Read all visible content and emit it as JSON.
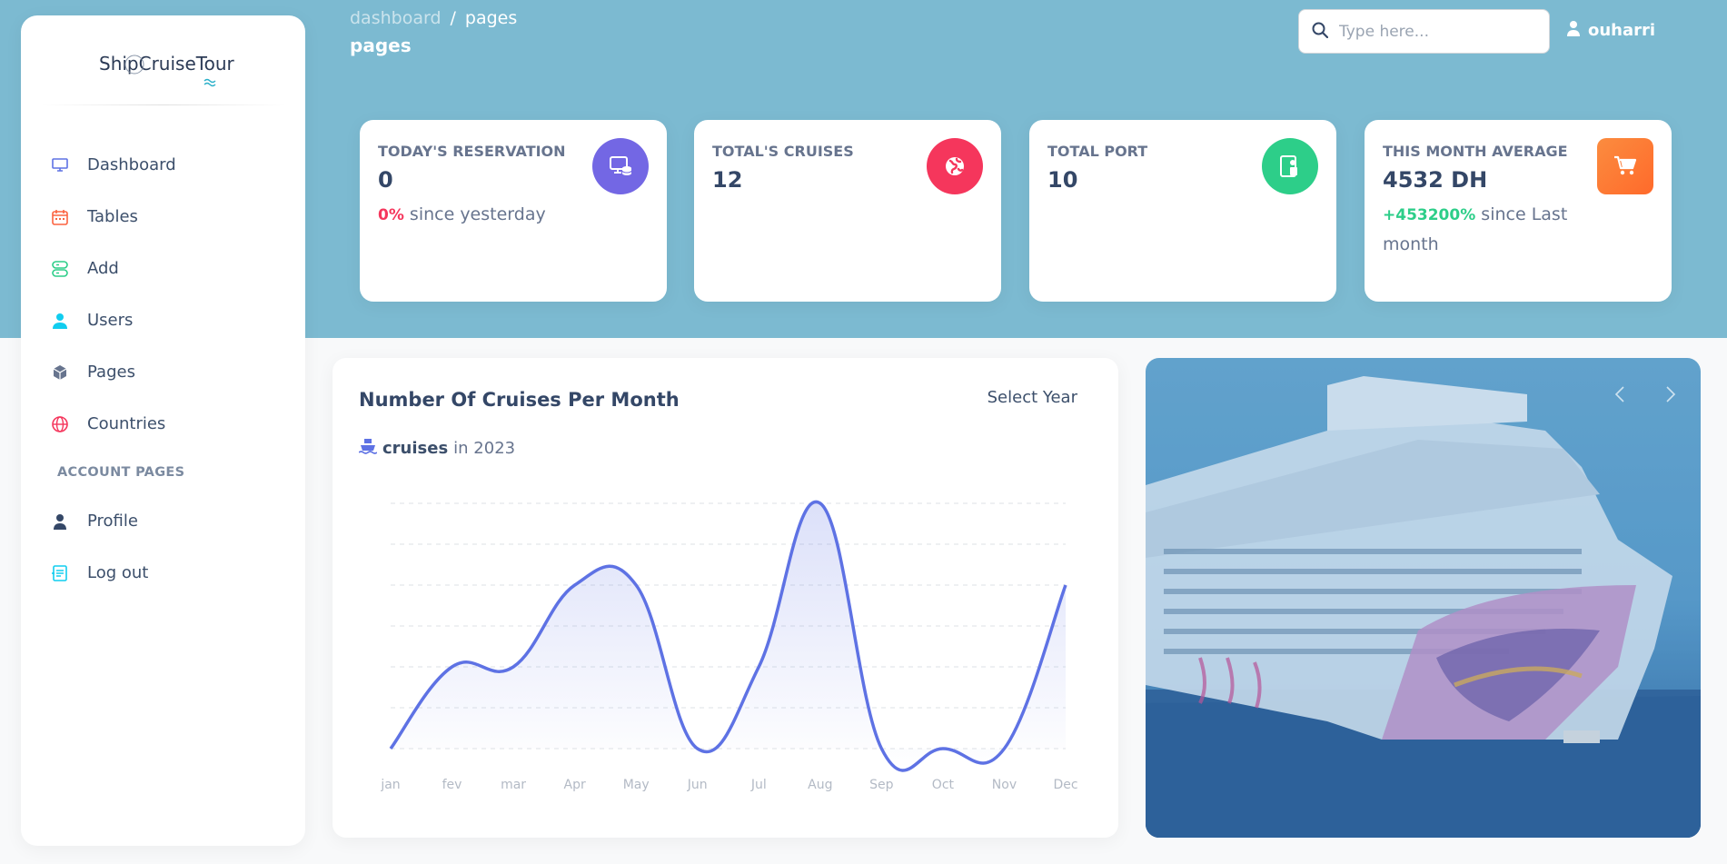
{
  "brand": {
    "logo_text": "ShipCruiseTour"
  },
  "sidebar": {
    "items": [
      {
        "label": "Dashboard",
        "icon": "monitor-icon",
        "color": "#5e72e4"
      },
      {
        "label": "Tables",
        "icon": "calendar-icon",
        "color": "#fb6340"
      },
      {
        "label": "Add",
        "icon": "add-grid-icon",
        "color": "#2dce89"
      },
      {
        "label": "Users",
        "icon": "user-icon",
        "color": "#11cdef"
      },
      {
        "label": "Pages",
        "icon": "box-icon",
        "color": "#67748e"
      },
      {
        "label": "Countries",
        "icon": "globe-icon",
        "color": "#f5365c"
      }
    ],
    "section_label": "ACCOUNT PAGES",
    "account_items": [
      {
        "label": "Profile",
        "icon": "person-icon",
        "color": "#344767"
      },
      {
        "label": "Log out",
        "icon": "logout-icon",
        "color": "#11cdef"
      }
    ]
  },
  "header": {
    "breadcrumb_root": "dashboard",
    "breadcrumb_sep": "/",
    "breadcrumb_current": "pages",
    "title": "pages",
    "search_placeholder": "Type here...",
    "username": "ouharri"
  },
  "stats": [
    {
      "label": "TODAY'S RESERVATION",
      "value": "0",
      "change_pct": "0%",
      "change_text": "since yesterday",
      "change_color": "#f5365c",
      "icon": "money-coins-icon",
      "badge_color": "#7367e4"
    },
    {
      "label": "TOTAL'S CRUISES",
      "value": "12",
      "change_pct": "",
      "change_text": "",
      "icon": "world-icon",
      "badge_color": "#f5365c"
    },
    {
      "label": "TOTAL PORT",
      "value": "10",
      "change_pct": "",
      "change_text": "",
      "icon": "paper-icon",
      "badge_color": "#2dce89"
    },
    {
      "label": "THIS MONTH AVERAGE",
      "value": "4532 DH",
      "change_pct": "+453200%",
      "change_text": "since Last month",
      "change_color": "#2dce89",
      "icon": "cart-icon",
      "badge_color": "#fb8c3f"
    }
  ],
  "chart": {
    "title": "Number Of Cruises Per Month",
    "select_label": "Select Year",
    "sub_bold": "cruises",
    "sub_text": "in 2023",
    "accent": "#5e72e4"
  },
  "chart_data": {
    "type": "line",
    "title": "Number Of Cruises Per Month",
    "categories": [
      "jan",
      "fev",
      "mar",
      "Apr",
      "May",
      "Jun",
      "Jul",
      "Aug",
      "Sep",
      "Oct",
      "Nov",
      "Dec"
    ],
    "series": [
      {
        "name": "cruises",
        "values": [
          0,
          2,
          2,
          4,
          4,
          0,
          2,
          6,
          0,
          0,
          0,
          4
        ]
      }
    ],
    "ylim": [
      0,
      6
    ],
    "grid": true,
    "xlabel": "",
    "ylabel": ""
  },
  "carousel": {
    "prev_icon": "chevron-left-icon",
    "next_icon": "chevron-right-icon"
  }
}
